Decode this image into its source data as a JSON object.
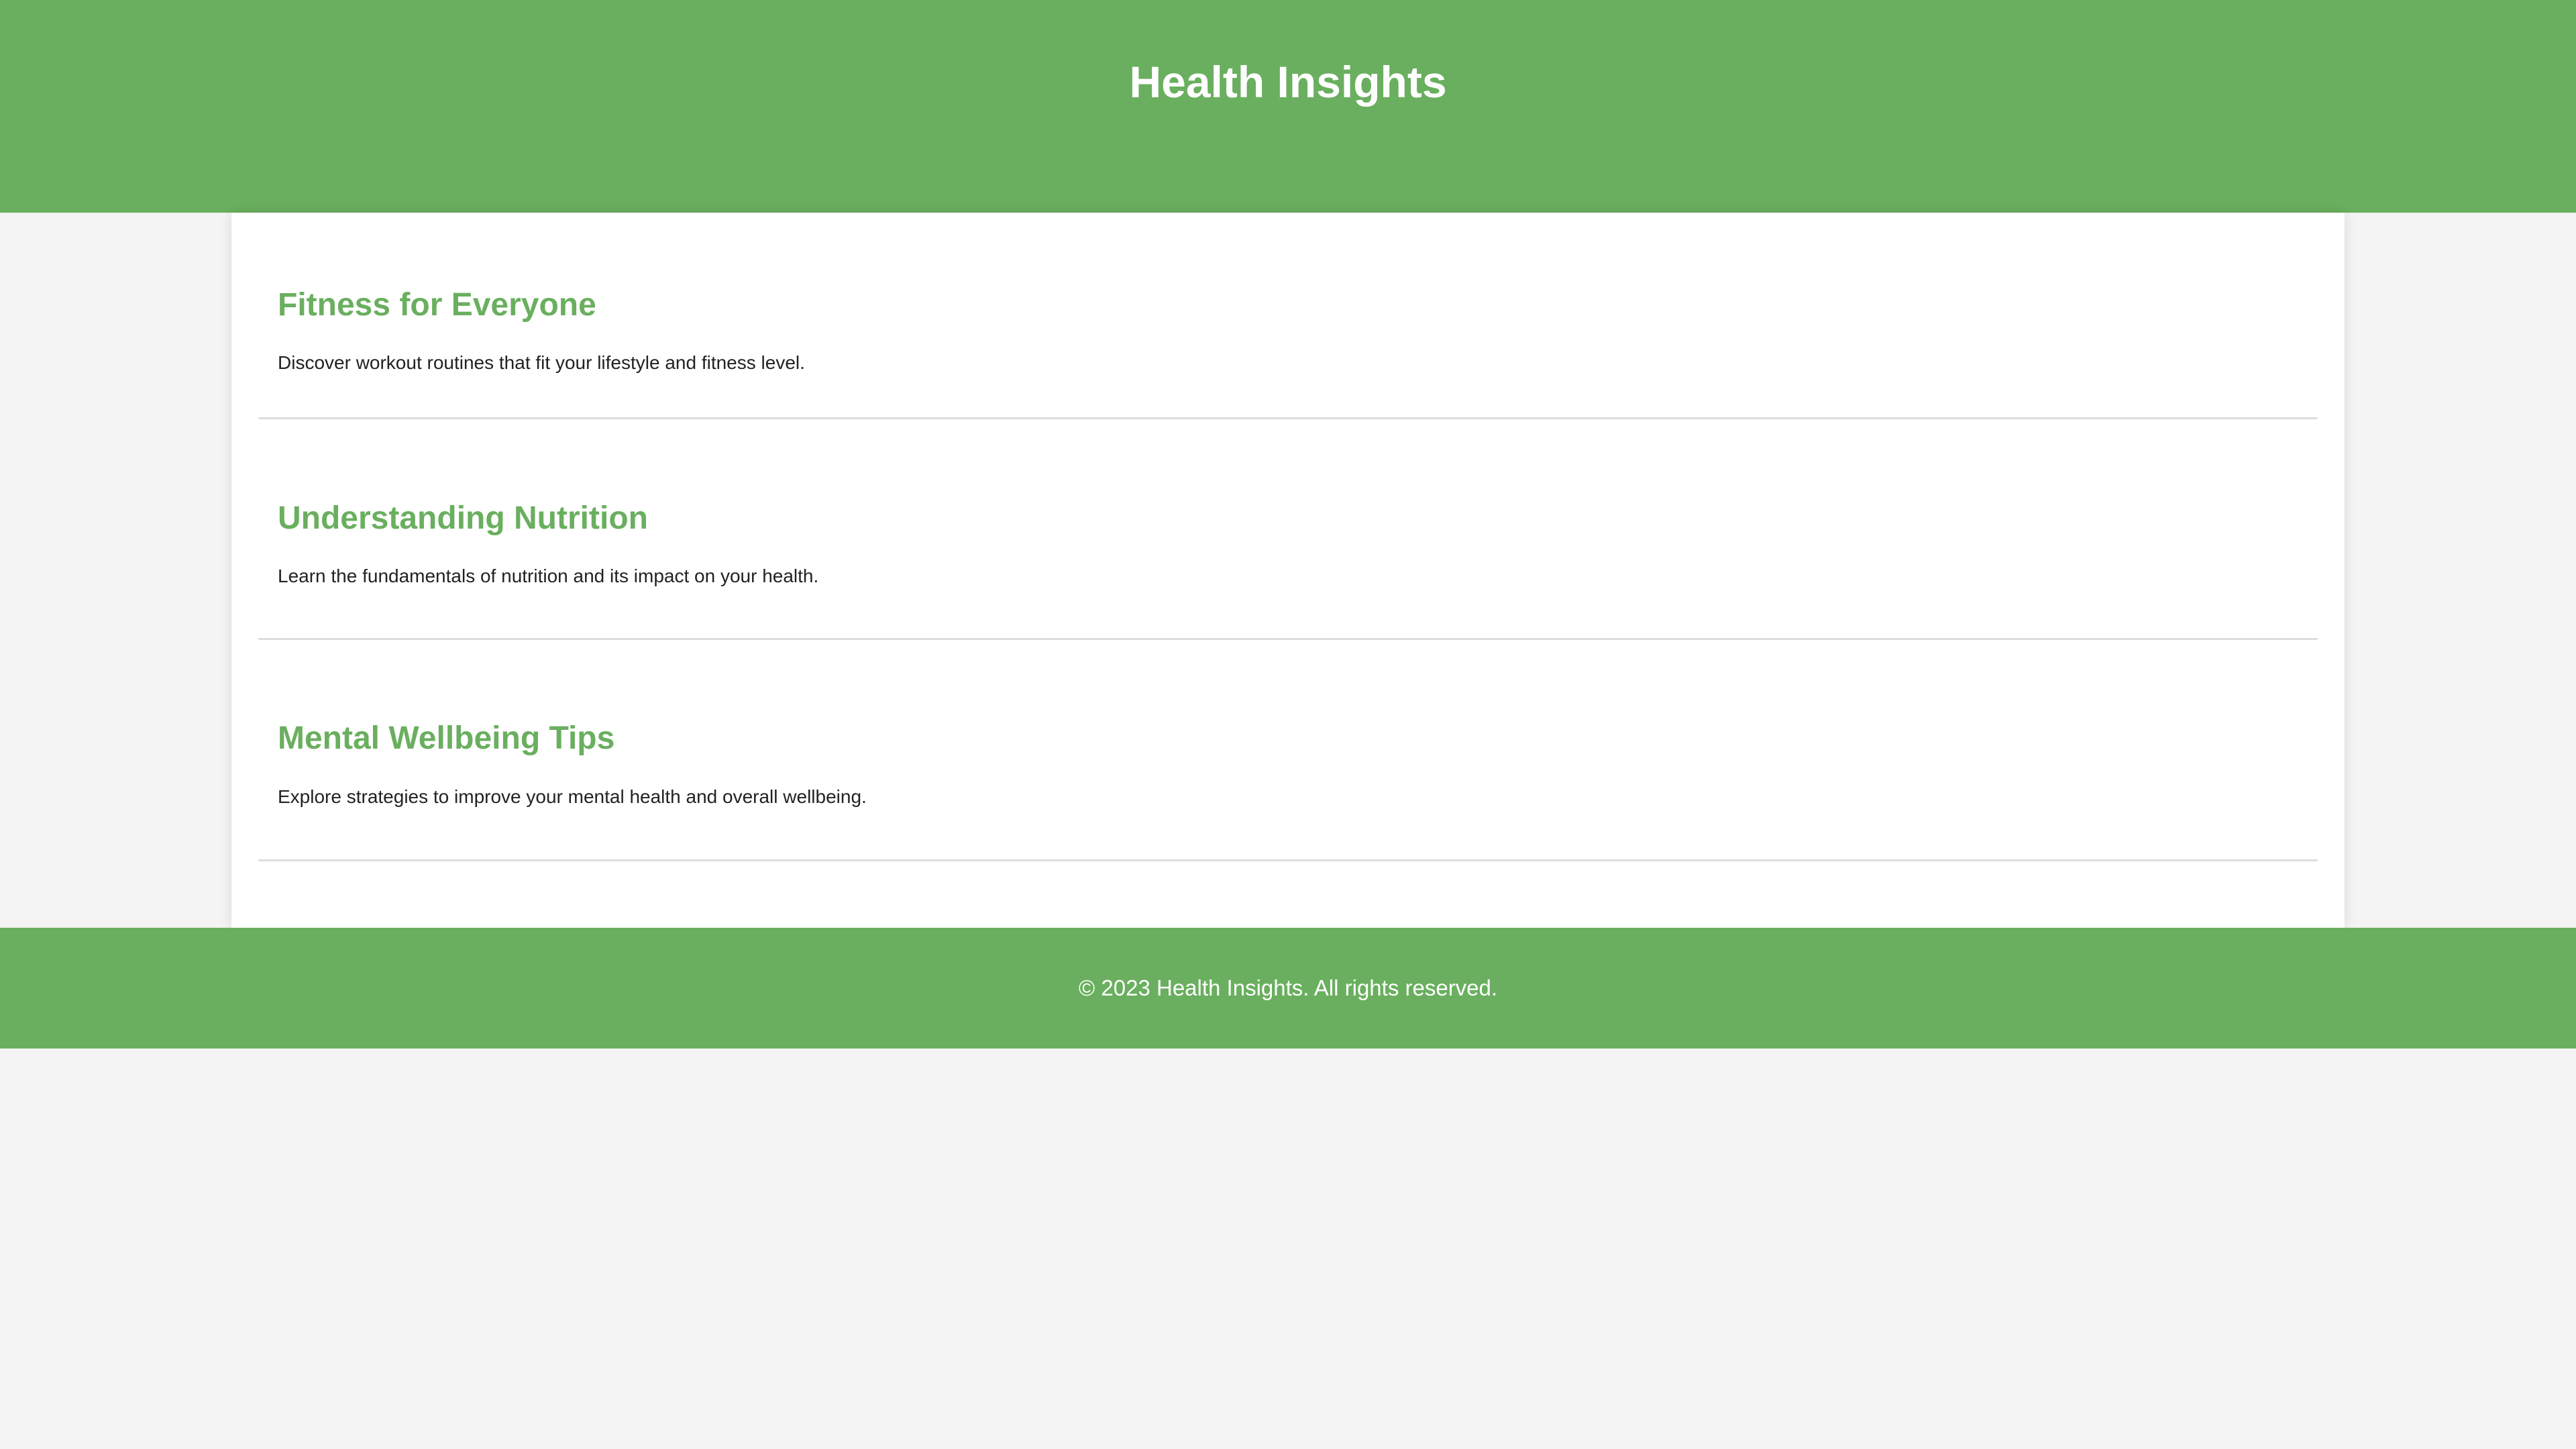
{
  "header": {
    "title": "Health Insights"
  },
  "articles": [
    {
      "title": "Fitness for Everyone",
      "description": "Discover workout routines that fit your lifestyle and fitness level."
    },
    {
      "title": "Understanding Nutrition",
      "description": "Learn the fundamentals of nutrition and its impact on your health."
    },
    {
      "title": "Mental Wellbeing Tips",
      "description": "Explore strategies to improve your mental health and overall wellbeing."
    }
  ],
  "footer": {
    "text": "© 2023 Health Insights. All rights reserved."
  },
  "colors": {
    "brand": "#6aaf5f",
    "background": "#f4f4f4",
    "card": "#ffffff",
    "divider": "#dddddd"
  }
}
